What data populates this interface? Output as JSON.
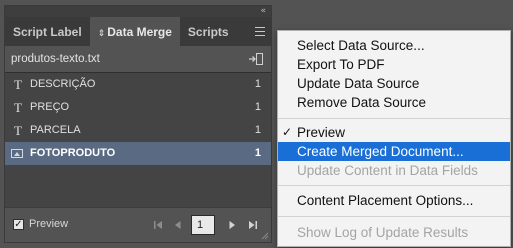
{
  "panel": {
    "tabs": [
      {
        "label": "Script Label"
      },
      {
        "label": "Data Merge",
        "prefix": "⇕"
      },
      {
        "label": "Scripts"
      }
    ],
    "source_file": "produtos-texto.txt",
    "fields": [
      {
        "type": "T",
        "name": "DESCRIÇÃO",
        "count": "1"
      },
      {
        "type": "T",
        "name": "PREÇO",
        "count": "1"
      },
      {
        "type": "T",
        "name": "PARCELA",
        "count": "1"
      },
      {
        "type": "image",
        "name": "FOTOPRODUTO",
        "count": "1"
      }
    ],
    "preview_label": "Preview",
    "page_number": "1"
  },
  "menu": {
    "items": [
      {
        "label": "Select Data Source...",
        "enabled": true
      },
      {
        "label": "Export To PDF",
        "enabled": true
      },
      {
        "label": "Update Data Source",
        "enabled": true
      },
      {
        "label": "Remove Data Source",
        "enabled": true
      },
      {
        "label": "Preview",
        "enabled": true,
        "checked": true
      },
      {
        "label": "Create Merged Document...",
        "enabled": true,
        "highlighted": true
      },
      {
        "label": "Update Content in Data Fields",
        "enabled": false
      },
      {
        "label": "Content Placement Options...",
        "enabled": true
      },
      {
        "label": "Show Log of Update Results",
        "enabled": false
      }
    ],
    "check_glyph": "✓"
  },
  "colors": {
    "panel_bg": "#535353",
    "list_bg": "#444444",
    "selected_row": "#5a6a82",
    "menu_highlight": "#1a6fd7",
    "menu_bg": "#f3f3f3"
  }
}
